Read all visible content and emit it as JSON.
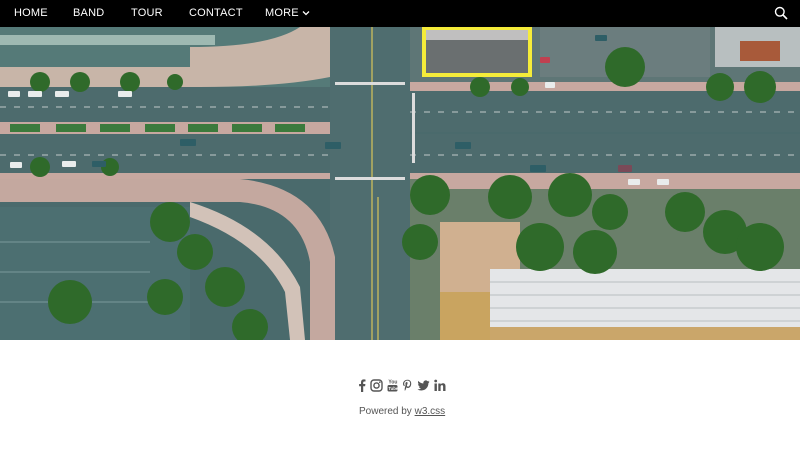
{
  "navbar": {
    "items": [
      {
        "label": "HOME"
      },
      {
        "label": "BAND"
      },
      {
        "label": "TOUR"
      },
      {
        "label": "CONTACT"
      },
      {
        "label": "MORE"
      }
    ],
    "background": "#000000",
    "text_color": "#ffffff",
    "icons": {
      "more": "chevron-down-icon",
      "search": "search-icon"
    }
  },
  "hero": {
    "icon": "aerial-intersection-image"
  },
  "footer": {
    "social_icons": [
      "facebook-icon",
      "instagram-icon",
      "youtube-icon",
      "pinterest-icon",
      "twitter-icon",
      "linkedin-icon"
    ],
    "powered_prefix": "Powered by",
    "powered_link": "w3.css"
  }
}
